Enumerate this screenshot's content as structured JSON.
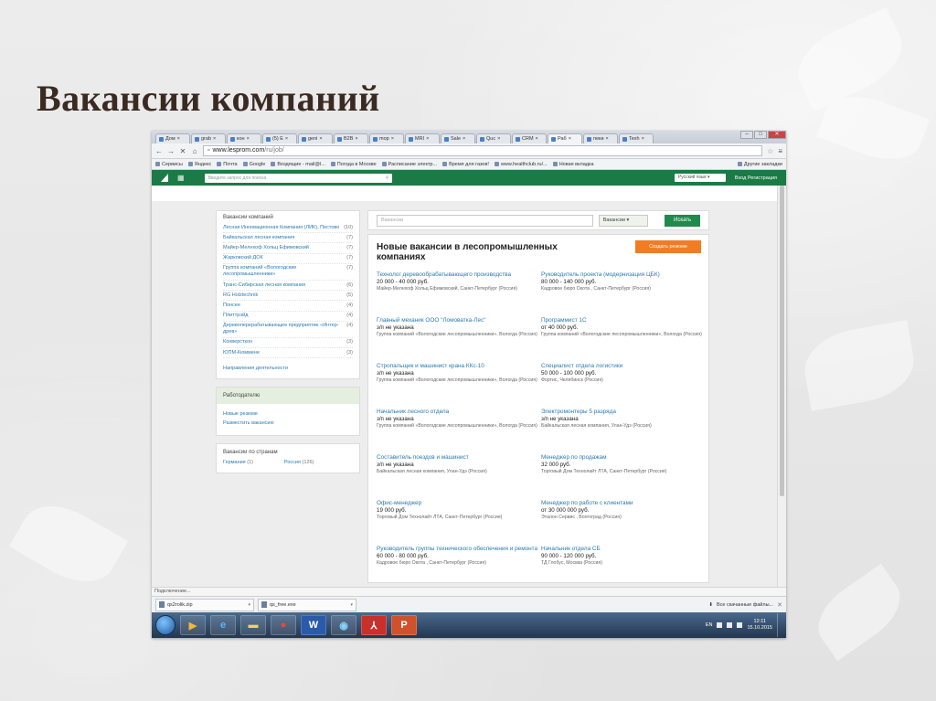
{
  "slide": {
    "title": "Вакансии компаний"
  },
  "browser": {
    "tabs": [
      {
        "label": "Дом",
        "active": false
      },
      {
        "label": "grab",
        "active": false
      },
      {
        "label": "кон",
        "active": false
      },
      {
        "label": "(5) Е",
        "active": false
      },
      {
        "label": "geni",
        "active": false
      },
      {
        "label": "B2B",
        "active": false
      },
      {
        "label": "mop",
        "active": false
      },
      {
        "label": "MRI",
        "active": false
      },
      {
        "label": "Sale",
        "active": false
      },
      {
        "label": "Quc",
        "active": false
      },
      {
        "label": "CRM",
        "active": false
      },
      {
        "label": "Раб",
        "active": true
      },
      {
        "label": "пеки",
        "active": false
      },
      {
        "label": "Texh",
        "active": false
      }
    ],
    "url_host": "www.lesprom.com",
    "url_path": "/ru/job/",
    "bookmarks": [
      "Сервисы",
      "Яндекс",
      "Почта",
      "Google",
      "Входящие - mail@l...",
      "Погода в Москве",
      "Расписание электр...",
      "Время для газов!",
      "www.healthclub.ru/...",
      "Новая вкладка",
      "Другие закладки"
    ],
    "status_text": "Подключение...",
    "downloads": [
      {
        "name": "qs2rolik.zip"
      },
      {
        "name": "qs_free.exe"
      }
    ],
    "downloads_all": "Все скачанные файлы..."
  },
  "site": {
    "search_placeholder": "Введите запрос для поиска",
    "language": "Русский язык",
    "auth": "Вход  Регистрация",
    "main_search_placeholder": "Вакансии",
    "category": "Вакансии",
    "find_button": "Искать",
    "resume_button": "Создать резюме",
    "vacancies_title": "Новые вакансии в лесопромышленных компаниях"
  },
  "left": {
    "companies_head": "Вакансии компаний",
    "companies": [
      {
        "name": "Лесная Инновационная Компания (ЛИК), Пестово",
        "count": "(10)"
      },
      {
        "name": "Байкальская лесная компания",
        "count": "(7)"
      },
      {
        "name": "Майер-Мелнхоф Хольц Ефимовский",
        "count": "(7)"
      },
      {
        "name": "Жарковский ДОК",
        "count": "(7)"
      },
      {
        "name": "Группа компаний «Вологодские лесопромышленники»",
        "count": "(7)"
      },
      {
        "name": "Транс-Сибирская лесная компания",
        "count": "(6)"
      },
      {
        "name": "RG Holztechnik",
        "count": "(5)"
      },
      {
        "name": "Понсее",
        "count": "(4)"
      },
      {
        "name": "Плиттрэйд",
        "count": "(4)"
      },
      {
        "name": "Деревоперерабатывающее предприятие «Интер-древ»",
        "count": "(4)"
      },
      {
        "name": "Конверсткон",
        "count": "(3)"
      },
      {
        "name": "ЮПМ-Кюммене",
        "count": "(3)"
      }
    ],
    "directions_link": "Направления деятельности",
    "employer_head": "Работодателю",
    "employer_links": [
      "Новые резюме",
      "Разместить вакансию"
    ],
    "countries_head": "Вакансии по странам",
    "countries": [
      {
        "name": "Германия",
        "count": "(1)"
      },
      {
        "name": "Россия",
        "count": "(126)"
      }
    ]
  },
  "vacancies": [
    {
      "title": "Технолог деревообрабатывающего производства",
      "salary": "20 000 - 40 000 руб.",
      "company": "Майер-Мелнхоф Хольц Ефимовский, Санкт-Петербург (Россия)"
    },
    {
      "title": "Руководитель проекта (модернизация ЦБК)",
      "salary": "80 000 - 140 000 руб.",
      "company": "Кадровое бюро Окота , Санкт-Петербург (Россия)"
    },
    {
      "title": "Главный механик ООО \"Ломоватка-Лес\"",
      "salary": "з/п не указана",
      "company": "Группа компаний «Вологодские лесопромышленники», Вологда (Россия)"
    },
    {
      "title": "Программист 1С",
      "salary": "от 40 000 руб.",
      "company": "Группа компаний «Вологодские лесопромышленники», Вологда (Россия)"
    },
    {
      "title": "Стропальщик и машинист крана ККс-10",
      "salary": "з/п не указана",
      "company": "Группа компаний «Вологодские лесопромышленники», Вологда (Россия)"
    },
    {
      "title": "Специалист отдела логистики",
      "salary": "50 000 - 100 000 руб.",
      "company": "Фортис, Челябинск (Россия)"
    },
    {
      "title": "Начальник лесного отдела",
      "salary": "з/п не указана",
      "company": "Группа компаний «Вологодские лесопромышленники», Вологда (Россия)"
    },
    {
      "title": "Электромонтеры 5 разряда",
      "salary": "з/п не указана",
      "company": "Байкальская лесная компания, Улан-Удэ (Россия)"
    },
    {
      "title": "Составитель поездов и машинист",
      "salary": "з/п не указана",
      "company": "Байкальская лесная компания, Улан-Удэ (Россия)"
    },
    {
      "title": "Менеджер по продажам",
      "salary": "32 000 руб.",
      "company": "Торговый Дом Технолайт ЛТА, Санкт-Петербург (Россия)"
    },
    {
      "title": "Офис-менеджер",
      "salary": "19 000 руб.",
      "company": "Торговый Дом Технолайт ЛТА, Санкт-Петербург (Россия)"
    },
    {
      "title": "Менеджер по работе с клиентами",
      "salary": "от 30 000 000 руб.",
      "company": "Эталон Сервис , Волгоград (Россия)"
    },
    {
      "title": "Руководитель группы технического обеспечения и ремонта",
      "salary": "60 000 - 80 000 руб.",
      "company": "Кадровое бюро Окота , Санкт-Петербург (Россия)"
    },
    {
      "title": "Начальник отдела СБ",
      "salary": "90 000 - 120 000 руб.",
      "company": "ТД Глобус, Москва (Россия)"
    }
  ],
  "taskbar": {
    "lang": "EN",
    "time": "12:11",
    "date": "15.10.2015"
  }
}
